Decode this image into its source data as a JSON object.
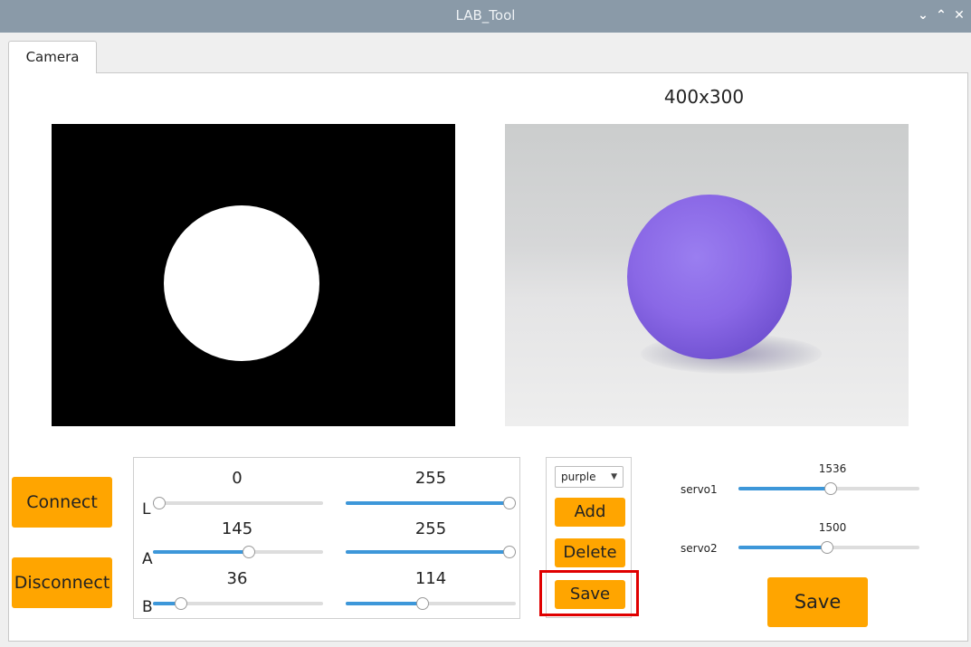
{
  "window": {
    "title": "LAB_Tool",
    "controls": [
      "chevron-down",
      "chevron-up",
      "close"
    ]
  },
  "tabs": [
    {
      "label": "Camera",
      "active": true
    }
  ],
  "camera": {
    "resolution": "400x300"
  },
  "buttons": {
    "connect": "Connect",
    "disconnect": "Disconnect"
  },
  "lab": {
    "L": {
      "label": "L",
      "min": "0",
      "max": "255",
      "min_level": 0.0,
      "max_level": 1.0
    },
    "A": {
      "label": "A",
      "min": "145",
      "max": "255",
      "min_level": 0.57,
      "max_level": 1.0
    },
    "B": {
      "label": "B",
      "min": "36",
      "max": "114",
      "min_level": 0.14,
      "max_level": 0.45
    }
  },
  "color_panel": {
    "selected": "purple",
    "add": "Add",
    "delete": "Delete",
    "save": "Save"
  },
  "servos": [
    {
      "label": "servo1",
      "value": "1536",
      "level": 0.51
    },
    {
      "label": "servo2",
      "value": "1500",
      "level": 0.49
    }
  ],
  "servo_save": "Save",
  "colors": {
    "accent_button": "#ffa500",
    "slider_fill": "#3d97d9",
    "highlight": "#e00000"
  }
}
